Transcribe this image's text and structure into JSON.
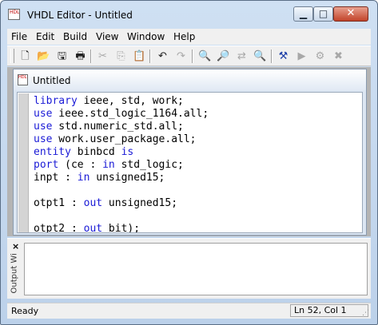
{
  "window": {
    "title": "VHDL Editor - Untitled",
    "icon": "hdl-file-icon",
    "controls": {
      "minimize": "minimize-icon",
      "maximize": "maximize-icon",
      "close": "close-icon"
    }
  },
  "menu": [
    {
      "label": "File"
    },
    {
      "label": "Edit"
    },
    {
      "label": "Build"
    },
    {
      "label": "View"
    },
    {
      "label": "Window"
    },
    {
      "label": "Help"
    }
  ],
  "toolbar": [
    {
      "icon": "new-file-icon",
      "enabled": true
    },
    {
      "icon": "open-folder-icon",
      "enabled": true
    },
    {
      "icon": "save-icon",
      "enabled": true
    },
    {
      "icon": "print-icon",
      "enabled": true
    },
    {
      "icon": "cut-icon",
      "enabled": false
    },
    {
      "icon": "copy-icon",
      "enabled": false
    },
    {
      "icon": "paste-icon",
      "enabled": false
    },
    {
      "icon": "undo-icon",
      "enabled": true
    },
    {
      "icon": "redo-icon",
      "enabled": false
    },
    {
      "icon": "find-icon",
      "enabled": true
    },
    {
      "icon": "find-next-icon",
      "enabled": false
    },
    {
      "icon": "replace-icon",
      "enabled": false
    },
    {
      "icon": "find-in-files-icon",
      "enabled": true
    },
    {
      "icon": "build-icon",
      "enabled": true
    },
    {
      "icon": "run-icon",
      "enabled": false
    },
    {
      "icon": "debug-icon",
      "enabled": false
    },
    {
      "icon": "stop-icon",
      "enabled": false
    }
  ],
  "document": {
    "tab_title": "Untitled",
    "code_lines": [
      [
        [
          "kw",
          "library"
        ],
        [
          "",
          " ieee, std, work;"
        ]
      ],
      [
        [
          "kw",
          "use"
        ],
        [
          "",
          " ieee.std_logic_1164.all;"
        ]
      ],
      [
        [
          "kw",
          "use"
        ],
        [
          "",
          " std.numeric_std.all;"
        ]
      ],
      [
        [
          "kw",
          "use"
        ],
        [
          "",
          " work.user_package.all;"
        ]
      ],
      [
        [
          "kw",
          "entity"
        ],
        [
          "",
          " binbcd "
        ],
        [
          "kw",
          "is"
        ]
      ],
      [
        [
          "kw",
          "port"
        ],
        [
          "",
          " (ce : "
        ],
        [
          "kw",
          "in"
        ],
        [
          "",
          " std_logic;"
        ]
      ],
      [
        [
          "",
          "inpt : "
        ],
        [
          "kw",
          "in"
        ],
        [
          "",
          " unsigned15;"
        ]
      ],
      [],
      [
        [
          "",
          "otpt1 : "
        ],
        [
          "kw",
          "out"
        ],
        [
          "",
          " unsigned15;"
        ]
      ],
      [],
      [
        [
          "",
          "otpt2 : "
        ],
        [
          "kw",
          "out"
        ],
        [
          "",
          " bit);"
        ]
      ]
    ]
  },
  "output_panel": {
    "close_label": "×",
    "title": "Output Wi"
  },
  "status": {
    "text": "Ready",
    "position": "Ln 52, Col 1"
  },
  "colors": {
    "keyword": "#1a1ad6",
    "frame": "#cfe0f3"
  }
}
